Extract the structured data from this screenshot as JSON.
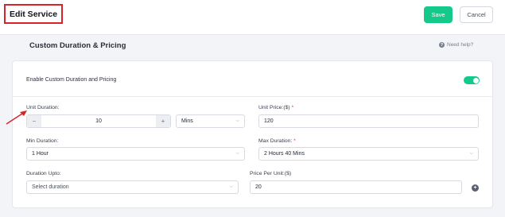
{
  "header": {
    "title": "Edit Service",
    "save_label": "Save",
    "cancel_label": "Cancel"
  },
  "section": {
    "title": "Custom Duration & Pricing",
    "help_label": "Need help?"
  },
  "enable": {
    "label": "Enable Custom Duration and Pricing",
    "toggle_on": true
  },
  "form": {
    "unit_duration": {
      "label": "Unit Duration:",
      "value": "10",
      "minus": "−",
      "plus": "+",
      "unit": "Mins"
    },
    "unit_price": {
      "label": "Unit Price:($)",
      "required": "*",
      "value": "120"
    },
    "min_duration": {
      "label": "Min Duration:",
      "value": "1 Hour"
    },
    "max_duration": {
      "label": "Max Duration:",
      "required": "*",
      "value": "2 Hours 40 Mins"
    },
    "duration_upto": {
      "label": "Duration Upto:",
      "placeholder": "Select duration"
    },
    "price_per_unit": {
      "label": "Price Per Unit:($)",
      "value": "20"
    },
    "add_icon": "+"
  },
  "colors": {
    "accent": "#14c98a",
    "highlight_box": "#d8232a",
    "required": "#e0343a"
  },
  "icons": {
    "help": "question-circle-icon",
    "chevron": "chevron-down-icon",
    "add": "plus-circle-icon",
    "annotation": "red-arrow-icon"
  }
}
